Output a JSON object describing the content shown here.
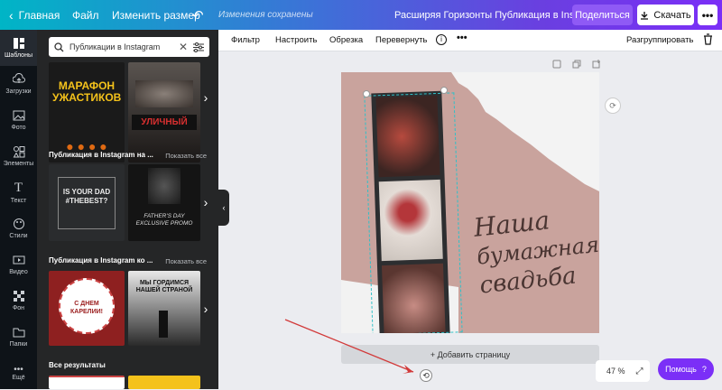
{
  "topbar": {
    "home": "Главная",
    "file": "Файл",
    "resize": "Изменить размер",
    "saved": "Изменения сохранены",
    "doc_title": "Расширяя Горизонты Публикация в Instagram",
    "share": "Поделиться",
    "download": "Скачать"
  },
  "rail": [
    "Шаблоны",
    "Загрузки",
    "Фото",
    "Элементы",
    "Текст",
    "Стили",
    "Видео",
    "Фон",
    "Папки",
    "Ещё"
  ],
  "panel": {
    "search_value": "Публикации в Instagram",
    "templates_row1": [
      "МАРАФОН УЖАСТИКОВ",
      "УЛИЧНЫЙ"
    ],
    "section2": {
      "title": "Публикация в Instagram на ...",
      "all": "Показать все"
    },
    "templates_row2": [
      "IS YOUR DAD #THEBEST?",
      "FATHER'S DAY EXCLUSIVE PROMO"
    ],
    "section3": {
      "title": "Публикация в Instagram ко ...",
      "all": "Показать все"
    },
    "templates_row3": [
      "С ДНЕМ КАРЕЛИИ!",
      "МЫ ГОРДИМСЯ НАШЕЙ СТРАНОЙ"
    ],
    "section4": {
      "title": "Все результаты"
    }
  },
  "toolbar": {
    "filter": "Фильтр",
    "adjust": "Настроить",
    "crop": "Обрезка",
    "flip": "Перевернуть",
    "ungroup": "Разгруппировать"
  },
  "design": {
    "text": [
      "Наша",
      "бумажная",
      "свадьба"
    ]
  },
  "canvas": {
    "add_page": "+ Добавить страницу",
    "zoom": "47 %",
    "help": "Помощь"
  },
  "colors": {
    "accent": "#7b2ff7",
    "panel": "#252627",
    "rail": "#0e1318",
    "paper": "#c9a39d",
    "selection": "#30c0c8"
  }
}
